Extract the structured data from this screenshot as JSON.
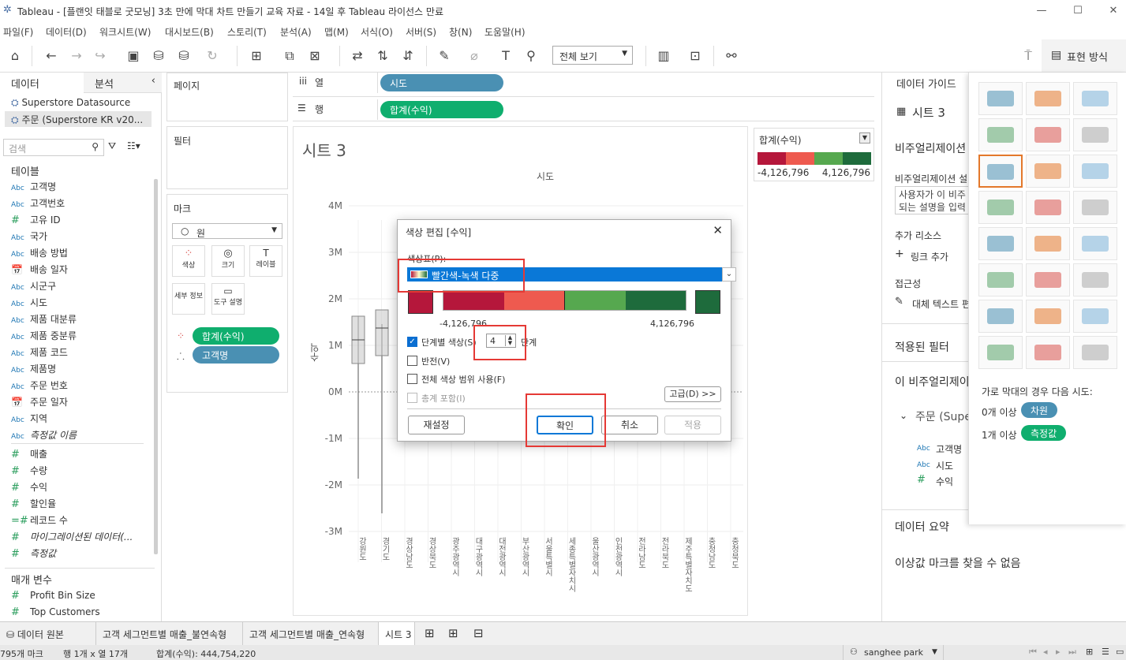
{
  "window": {
    "title": "Tableau - [플랜잇 태블로 굿모닝] 3초 만에 막대 차트 만들기 교육 자료 - 14일 후 Tableau 라이선스 만료"
  },
  "menu": [
    "파일(F)",
    "데이터(D)",
    "워크시트(W)",
    "대시보드(B)",
    "스토리(T)",
    "분석(A)",
    "맵(M)",
    "서식(O)",
    "서버(S)",
    "창(N)",
    "도움말(H)"
  ],
  "toolbar": {
    "view_select": "전체 보기",
    "showme_label": "표현 방식"
  },
  "left": {
    "tab_data": "데이터",
    "tab_analysis": "분석",
    "sources": [
      "Superstore Datasource",
      "주문 (Superstore KR v20..."
    ],
    "search_placeholder": "검색",
    "tables_header": "테이블",
    "dimensions": [
      {
        "type": "Abc",
        "name": "고객명"
      },
      {
        "type": "Abc",
        "name": "고객번호"
      },
      {
        "type": "#",
        "name": "고유 ID"
      },
      {
        "type": "Abc",
        "name": "국가"
      },
      {
        "type": "Abc",
        "name": "배송 방법"
      },
      {
        "type": "date",
        "name": "배송 일자"
      },
      {
        "type": "Abc",
        "name": "시군구"
      },
      {
        "type": "Abc",
        "name": "시도"
      },
      {
        "type": "Abc",
        "name": "제품 대분류"
      },
      {
        "type": "Abc",
        "name": "제품 중분류"
      },
      {
        "type": "Abc",
        "name": "제품 코드"
      },
      {
        "type": "Abc",
        "name": "제품명"
      },
      {
        "type": "Abc",
        "name": "주문 번호"
      },
      {
        "type": "date",
        "name": "주문 일자"
      },
      {
        "type": "Abc",
        "name": "지역"
      },
      {
        "type": "Abc",
        "name": "측정값 이름"
      }
    ],
    "measures": [
      {
        "type": "#",
        "name": "매출"
      },
      {
        "type": "#",
        "name": "수량"
      },
      {
        "type": "#",
        "name": "수익"
      },
      {
        "type": "#",
        "name": "할인율"
      },
      {
        "type": "=#",
        "name": "레코드 수"
      },
      {
        "type": "#",
        "name": "마이그레이션된 데이터(..."
      },
      {
        "type": "#",
        "name": "측정값"
      }
    ],
    "params_header": "매개 변수",
    "params": [
      "Profit Bin Size",
      "Top Customers"
    ]
  },
  "shelves": {
    "pages": "페이지",
    "filters": "필터",
    "marks": "마크",
    "mark_type": "원",
    "mark_buttons": [
      "색상",
      "크기",
      "레이블",
      "세부 정보",
      "도구 설명"
    ],
    "mark_pills": [
      "합계(수익)",
      "고객명"
    ],
    "columns_label": "열",
    "rows_label": "행",
    "columns_pill": "시도",
    "rows_pill": "합계(수익)"
  },
  "sheet": {
    "title": "시트 3",
    "x_header": "시도",
    "y_axis_label": "수익",
    "y_ticks": [
      "4M",
      "3M",
      "2M",
      "1M",
      "0M",
      "-1M",
      "-2M",
      "-3M"
    ],
    "x_labels": [
      "강원도",
      "경기도",
      "경상남도",
      "경상북도",
      "광주광역시",
      "대구광역시",
      "대전광역시",
      "부산광역시",
      "서울특별시",
      "세종특별자치시",
      "울산광역시",
      "인천광역시",
      "전라남도",
      "전라북도",
      "제주특별자치도",
      "충청남도",
      "충청북도"
    ]
  },
  "legend": {
    "title": "합계(수익)",
    "min": "-4,126,796",
    "max": "4,126,796",
    "colors": [
      "#b5173b",
      "#ee5a4f",
      "#56a84f",
      "#1e6b3c"
    ]
  },
  "dialog": {
    "title": "색상 편집 [수익]",
    "palette_label": "색상표(P):",
    "palette_value": "빨간색-녹색 다중",
    "min_value": "-4,126,796",
    "max_value": "4,126,796",
    "stepped_label": "단계별 색상(S)",
    "steps": "4",
    "steps_unit": "단계",
    "reverse_label": "반전(V)",
    "full_range_label": "전체 색상 범위 사용(F)",
    "include_totals_label": "총계 포함(I)",
    "advanced_button": "고급(D) >>",
    "reset_button": "재설정",
    "ok_button": "확인",
    "cancel_button": "취소",
    "apply_button": "적용"
  },
  "guide": {
    "tab": "데이터 가이드",
    "sheet_name": "시트 3",
    "viz_header": "비주얼리제이션",
    "viz_desc_label": "비주얼리제이션 설",
    "viz_desc_placeholder_1": "사용자가 이 비주",
    "viz_desc_placeholder_2": "되는 설명을 입력",
    "resources": "추가 리소스",
    "add_link": "링크 추가",
    "accessibility": "접근성",
    "alt_text": "대체 텍스트 편",
    "applied_filters": "적용된 필터",
    "this_viz": "이 비주얼리제이",
    "source_node": "주문 (Supe",
    "fields": [
      {
        "type": "Abc",
        "name": "고객명"
      },
      {
        "type": "Abc",
        "name": "시도"
      },
      {
        "type": "#",
        "name": "수익"
      }
    ],
    "data_summary": "데이터 요약",
    "outliers": "이상값 마크를 찾을 수 없음"
  },
  "showme": {
    "hint": "가로 막대의 경우 다음 시도:",
    "req1_prefix": "0개 이상",
    "req1_pill": "차원",
    "req2_prefix": "1개 이상",
    "req2_pill": "측정값"
  },
  "tabs": [
    "데이터 원본",
    "고객 세그먼트별 매출_불연속형",
    "고객 세그먼트별 매출_연속형",
    "시트 3"
  ],
  "status": {
    "marks": "795개 마크",
    "rows_cols": "행 1개 x 열 17개",
    "sum": "합계(수익): 444,754,220",
    "user": "sanghee park"
  }
}
